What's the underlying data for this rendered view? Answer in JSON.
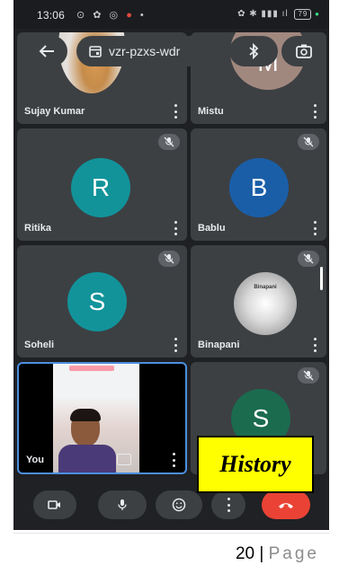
{
  "status_bar": {
    "time": "13:06",
    "battery": "79"
  },
  "header": {
    "meeting_code": "vzr-pzxs-wdr"
  },
  "participants": [
    {
      "name": "Sujay Kumar"
    },
    {
      "name": "Mistu",
      "initial": "M",
      "color": "#a1887f"
    },
    {
      "name": "Ritika",
      "initial": "R",
      "color": "#12939a"
    },
    {
      "name": "Bablu",
      "initial": "B",
      "color": "#1a5ea8"
    },
    {
      "name": "Soheli",
      "initial": "S",
      "color": "#12939a"
    },
    {
      "name": "Binapani",
      "photo_label": "Binapani"
    },
    {
      "name": "You"
    },
    {
      "name": "S",
      "initial": "S",
      "color": "#1b6b4f"
    }
  ],
  "overlay": {
    "label": "History"
  },
  "footer": {
    "page_number": "20",
    "separator": "|",
    "page_word": "Page"
  }
}
